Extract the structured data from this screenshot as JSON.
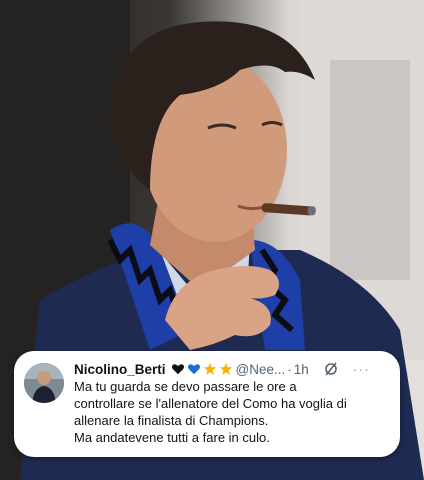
{
  "photo": {
    "subject": "man-smoking-cigar-with-inter-scarf"
  },
  "tweet": {
    "display_name": "Nicolino_Berti",
    "emojis": [
      "black-heart",
      "blue-heart",
      "star",
      "star"
    ],
    "handle": "@Nee...",
    "separator": "·",
    "time": "1h",
    "lines": [
      "Ma tu guarda se devo passare le ore a",
      "controllare se l'allenatore del Como ha voglia di",
      "allenare la finalista di Champions.",
      "Ma andatevene tutti a fare in culo."
    ],
    "more_label": "···"
  },
  "colors": {
    "card_bg": "#ffffff",
    "text": "#0f1419",
    "secondary": "#536471",
    "scarf_blue": "#1f3fa8"
  }
}
